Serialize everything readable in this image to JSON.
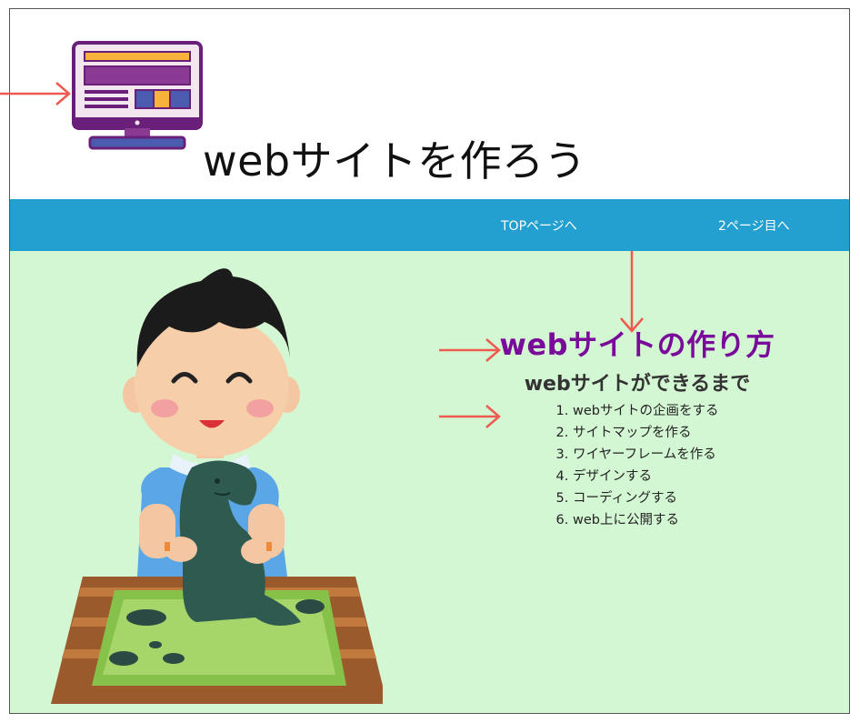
{
  "header": {
    "title": "webサイトを作ろう",
    "logo_icon": "computer-monitor-icon"
  },
  "nav": {
    "items": [
      {
        "label": "TOPページへ"
      },
      {
        "label": "2ページ目へ"
      }
    ],
    "bg_color": "#23a0cf"
  },
  "main": {
    "bg_color": "#d4f7d3",
    "heading": "webサイトの作り方",
    "heading_color": "#7a0a9a",
    "subheading": "webサイトができるまで",
    "steps": [
      "1. webサイトの企画をする",
      "2. サイトマップを作る",
      "3. ワイヤーフレームを作る",
      "4. デザインする",
      "5. コーディングする",
      "6. web上に公開する"
    ],
    "illustration_icon": "boy-clay-sculpting-illustration"
  },
  "annotation": {
    "arrow_color": "#ee5a4f"
  }
}
